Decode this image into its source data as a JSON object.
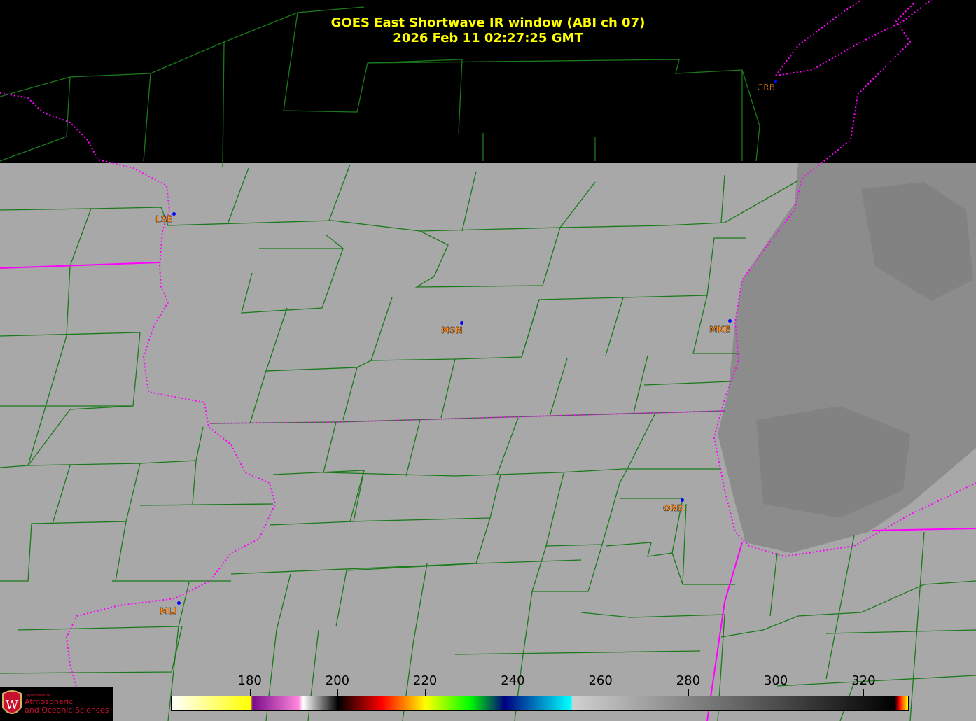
{
  "title": {
    "line1": "GOES East Shortwave IR window (ABI ch 07)",
    "line2": "2026 Feb 11  02:27:25 GMT"
  },
  "stations": [
    {
      "id": "GRB"
    },
    {
      "id": "LSE"
    },
    {
      "id": "MSN"
    },
    {
      "id": "MKE"
    },
    {
      "id": "ORD"
    },
    {
      "id": "MLI"
    }
  ],
  "colorbar": {
    "ticks": [
      "180",
      "200",
      "220",
      "240",
      "260",
      "280",
      "300",
      "320"
    ],
    "stops": [
      {
        "value": 162,
        "color": "#ffffff"
      },
      {
        "value": 180,
        "color": "#ffff00"
      },
      {
        "value": 180.5,
        "color": "#7a0a8a"
      },
      {
        "value": 191,
        "color": "#ff88dd"
      },
      {
        "value": 192,
        "color": "#ffffff"
      },
      {
        "value": 200,
        "color": "#000000"
      },
      {
        "value": 210,
        "color": "#ff0000"
      },
      {
        "value": 220,
        "color": "#ffff00"
      },
      {
        "value": 230,
        "color": "#00ff00"
      },
      {
        "value": 238,
        "color": "#000080"
      },
      {
        "value": 253,
        "color": "#00ffff"
      },
      {
        "value": 253.5,
        "color": "#d0d0d0"
      },
      {
        "value": 327,
        "color": "#000000"
      },
      {
        "value": 328,
        "color": "#ff0000"
      },
      {
        "value": 330,
        "color": "#ffff00"
      }
    ],
    "range": [
      162,
      330
    ]
  },
  "logo": {
    "line1": "Department of",
    "line2": "Atmospheric",
    "line3": "and Oceanic Sciences",
    "letter": "W"
  },
  "colors": {
    "county_lines": "#1a7a1a",
    "state_borders": "#ff00ff",
    "title": "#ffff00",
    "station_label": "#ff8c1a",
    "station_dot": "#0000ff",
    "land": "#a6a6a6",
    "lake": "#8a8a8a"
  }
}
